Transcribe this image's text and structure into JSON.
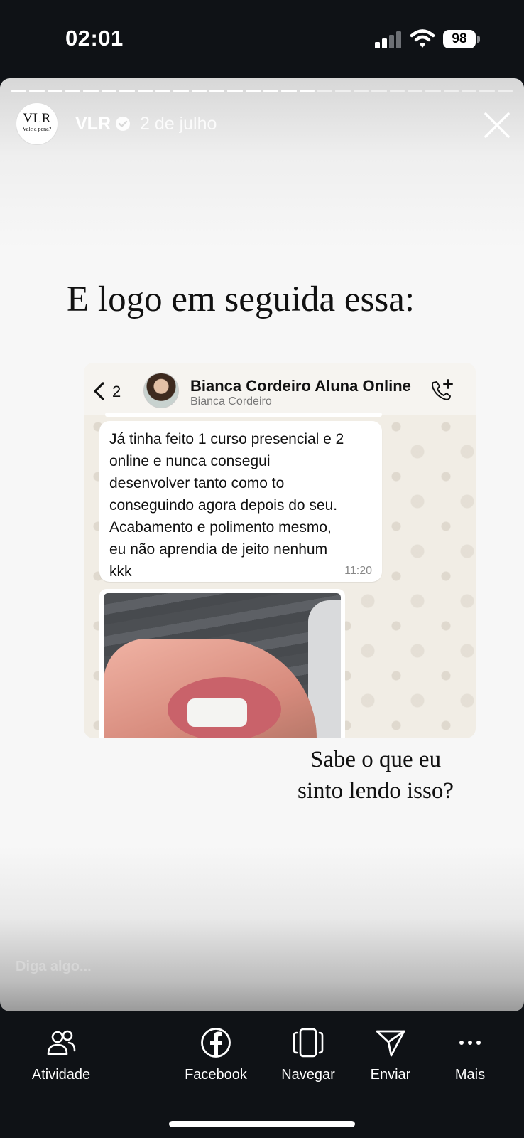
{
  "status_bar": {
    "time": "02:01",
    "battery": "98"
  },
  "story": {
    "progress": {
      "total_segments": 28,
      "completed_segments": 17
    },
    "avatar": {
      "monogram": "VLR",
      "tagline": "Vale a pena?"
    },
    "username": "VLR",
    "date": "2 de julho",
    "headline": "E logo em seguida essa:",
    "caption_lines": [
      "Sabe o que eu",
      "sinto lendo isso?"
    ],
    "reply_placeholder": "Diga algo..."
  },
  "chat": {
    "back_count": "2",
    "contact_name": "Bianca Cordeiro Aluna Online",
    "contact_subtitle": "Bianca Cordeiro",
    "message_lines": [
      "Já tinha feito 1 curso presencial e 2",
      "online e nunca consegui",
      "desenvolver tanto como to",
      "conseguindo agora depois do seu.",
      "Acabamento e polimento mesmo,",
      "eu não aprendia de jeito nenhum",
      "kkk"
    ],
    "message_time": "11:20"
  },
  "actions": [
    {
      "label": "Atividade",
      "icon": "activity-icon"
    },
    {
      "label": "Facebook",
      "icon": "facebook-icon"
    },
    {
      "label": "Navegar",
      "icon": "browse-icon"
    },
    {
      "label": "Enviar",
      "icon": "send-icon"
    },
    {
      "label": "Mais",
      "icon": "more-icon"
    }
  ]
}
